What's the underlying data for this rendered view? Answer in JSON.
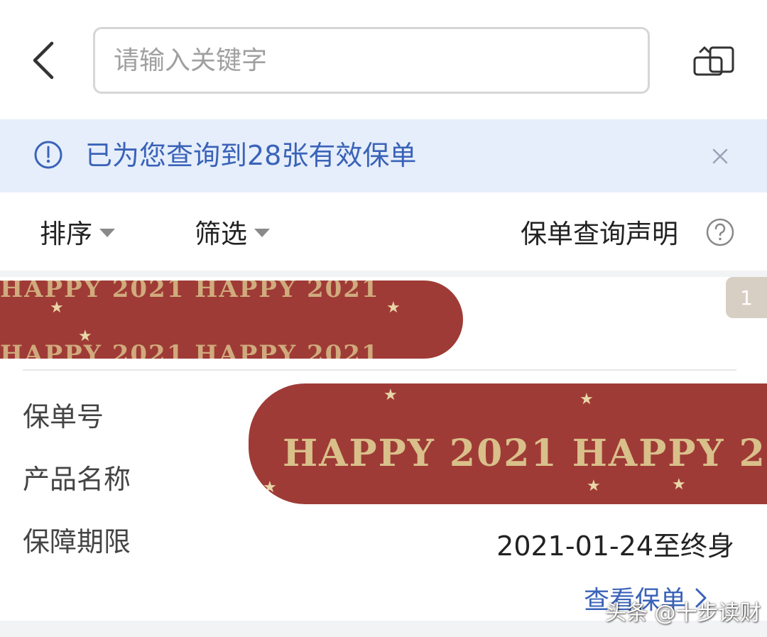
{
  "header": {
    "back_icon": "chevron-left-icon",
    "search_placeholder": "请输入关键字",
    "switch_icon": "switch-view-icon"
  },
  "notice": {
    "icon": "info-circle-icon",
    "text": "已为您查询到28张有效保单",
    "close_icon": "close-icon"
  },
  "toolbar": {
    "sort_label": "排序",
    "filter_label": "筛选",
    "declaration_label": "保单查询声明",
    "help_icon": "question-circle-icon"
  },
  "card": {
    "index": "1",
    "fields": {
      "policy_no_label": "保单号",
      "product_name_label": "产品名称",
      "term_label": "保障期限",
      "term_value": "2021-01-24至终身"
    },
    "redaction_text_small": "HAPPY 2021 HAPPY 2021",
    "redaction_text_large": "HAPPY 2021 HAPPY 2",
    "view_link": "查看保单"
  },
  "watermark": "头条 @十步读财",
  "colors": {
    "accent_blue": "#3a63b8",
    "notice_bg": "#e6eefb",
    "redaction_red": "#9f3b36",
    "badge_bg": "#d8cfc4"
  }
}
